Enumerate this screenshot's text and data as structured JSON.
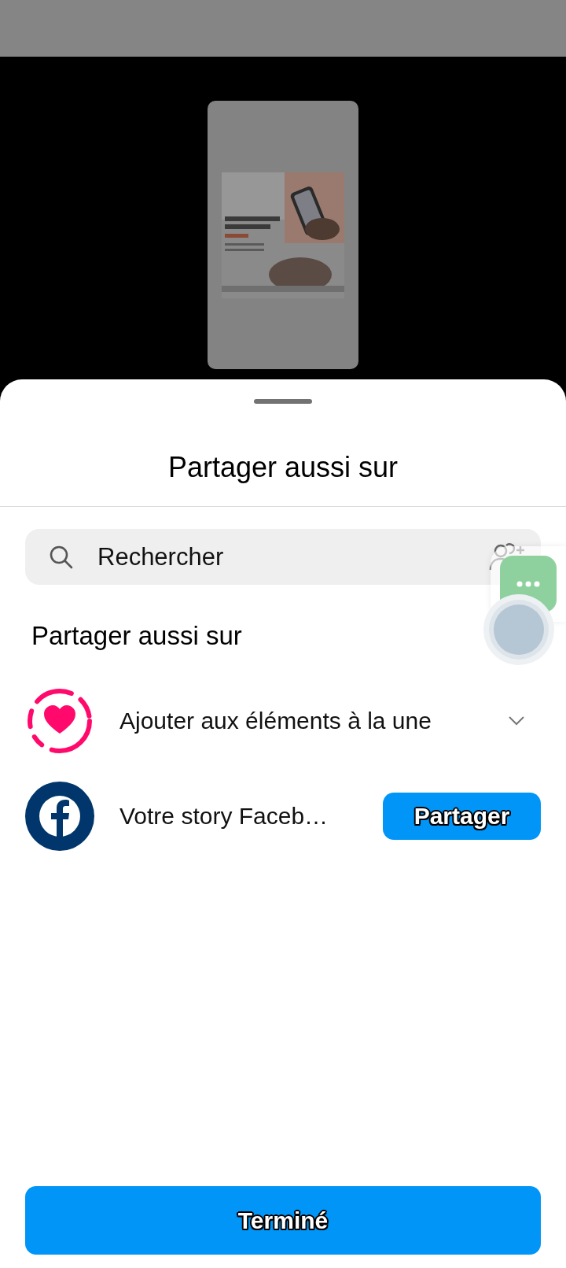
{
  "sheet": {
    "title": "Partager aussi sur",
    "search": {
      "placeholder": "Rechercher"
    },
    "section_title": "Partager aussi sur",
    "options": [
      {
        "kind": "highlight",
        "label": "Ajouter aux éléments à la une",
        "expanded": false
      },
      {
        "kind": "facebook",
        "label": "Votre story Faceb…",
        "button": "Partager"
      }
    ],
    "done_button": "Terminé"
  }
}
